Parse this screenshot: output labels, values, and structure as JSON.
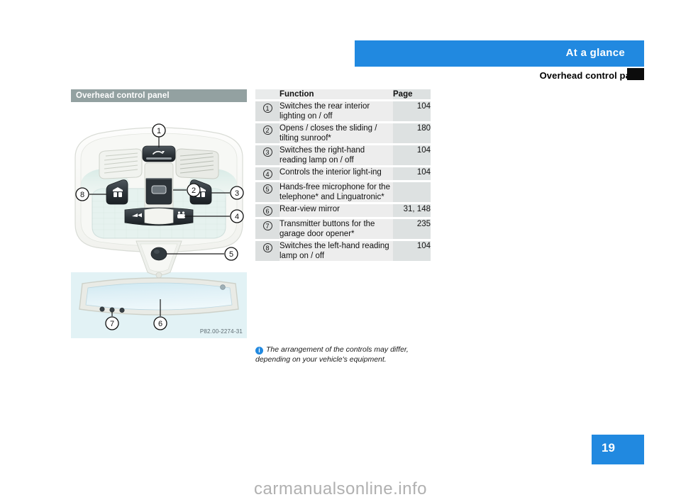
{
  "header": {
    "band_title": "At a glance",
    "section_title": "Overhead control panel"
  },
  "figure": {
    "caption": "Overhead control panel",
    "code": "P82.00-2274-31",
    "callouts": [
      "1",
      "2",
      "3",
      "4",
      "5",
      "6",
      "7",
      "8"
    ]
  },
  "table": {
    "columns": {
      "number": "",
      "function": "Function",
      "page": "Page"
    },
    "rows": [
      {
        "num": "1",
        "function": "Switches the rear interior lighting on / off",
        "page": "104"
      },
      {
        "num": "2",
        "function": "Opens / closes the sliding / tilting sunroof*",
        "page": "180"
      },
      {
        "num": "3",
        "function": "Switches the right-hand reading lamp on / off",
        "page": "104"
      },
      {
        "num": "4",
        "function": "Controls the interior light-ing",
        "page": "104"
      },
      {
        "num": "5",
        "function": "Hands-free microphone for the telephone* and Linguatronic*",
        "page": ""
      },
      {
        "num": "6",
        "function": "Rear-view mirror",
        "page": "31, 148"
      },
      {
        "num": "7",
        "function": "Transmitter buttons for the garage door opener*",
        "page": "235"
      },
      {
        "num": "8",
        "function": "Switches the left-hand reading lamp on / off",
        "page": "104"
      }
    ]
  },
  "note": {
    "icon": "info-icon",
    "text": "The arrangement of the controls may differ, depending on your vehicle's equipment."
  },
  "page": {
    "number": "19"
  },
  "watermark": "carmanualsonline.info",
  "colors": {
    "accent_blue": "#2189e0",
    "caption_gray": "#93a1a1",
    "row_gray": "#ededed",
    "page_col_gray": "#dde1e1",
    "num_col_gray": "#dcdfdf"
  }
}
